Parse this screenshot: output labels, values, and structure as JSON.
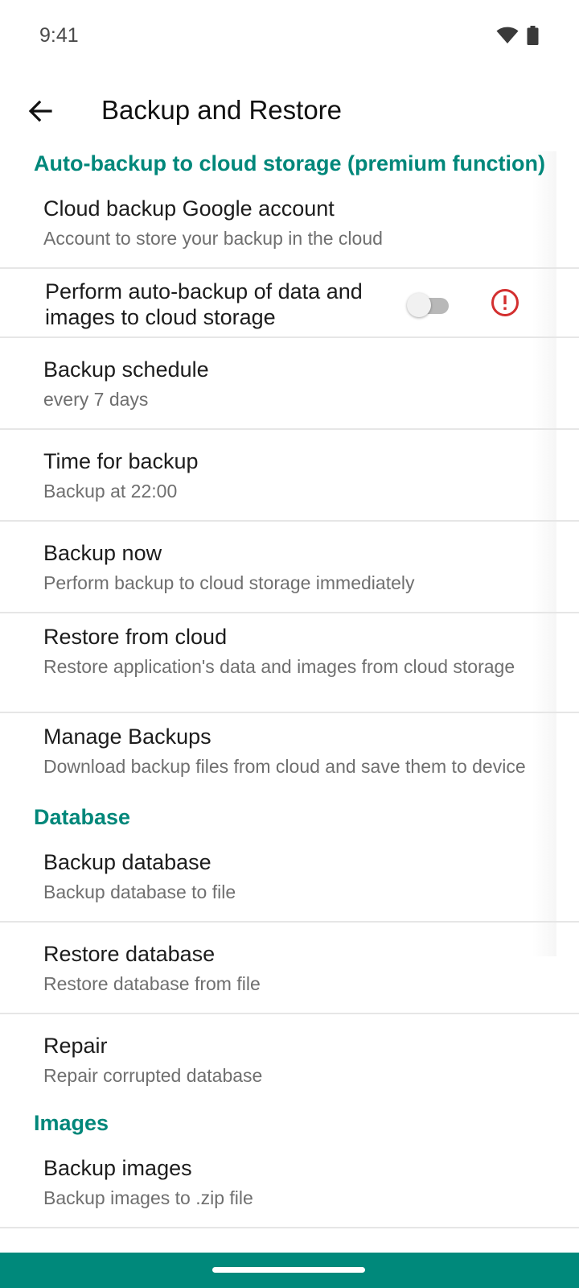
{
  "status_bar": {
    "time": "9:41",
    "icons": [
      "wifi-icon",
      "battery-icon"
    ]
  },
  "app_bar": {
    "back_icon": "arrow-left-icon",
    "title": "Backup and Restore"
  },
  "colors": {
    "accent": "#00877a",
    "nav_bar": "#00897b",
    "alert": "#d32f2f"
  },
  "sections": {
    "cloud": {
      "header": "Auto-backup to cloud storage (premium function)",
      "account": {
        "title": "Cloud backup Google account",
        "summary": "Account to store your backup in the cloud"
      },
      "auto_backup": {
        "title": "Perform auto-backup of data and images to cloud storage",
        "enabled": false,
        "alert_icon": "error-circle-icon"
      },
      "schedule": {
        "title": "Backup schedule",
        "summary": "every 7 days"
      },
      "time": {
        "title": "Time for backup",
        "summary": "Backup at 22:00"
      },
      "backup_now": {
        "title": "Backup now",
        "summary": "Perform backup to cloud storage immediately"
      },
      "restore_cloud": {
        "title": "Restore from cloud",
        "summary": "Restore application's data and images from cloud storage"
      },
      "manage": {
        "title": "Manage Backups",
        "summary": "Download backup files from cloud and save them to device"
      }
    },
    "database": {
      "header": "Database",
      "backup": {
        "title": "Backup database",
        "summary": "Backup database to file"
      },
      "restore": {
        "title": "Restore database",
        "summary": "Restore database from file"
      },
      "repair": {
        "title": "Repair",
        "summary": "Repair corrupted database"
      }
    },
    "images": {
      "header": "Images",
      "backup": {
        "title": "Backup images",
        "summary": "Backup images to .zip file"
      }
    }
  }
}
